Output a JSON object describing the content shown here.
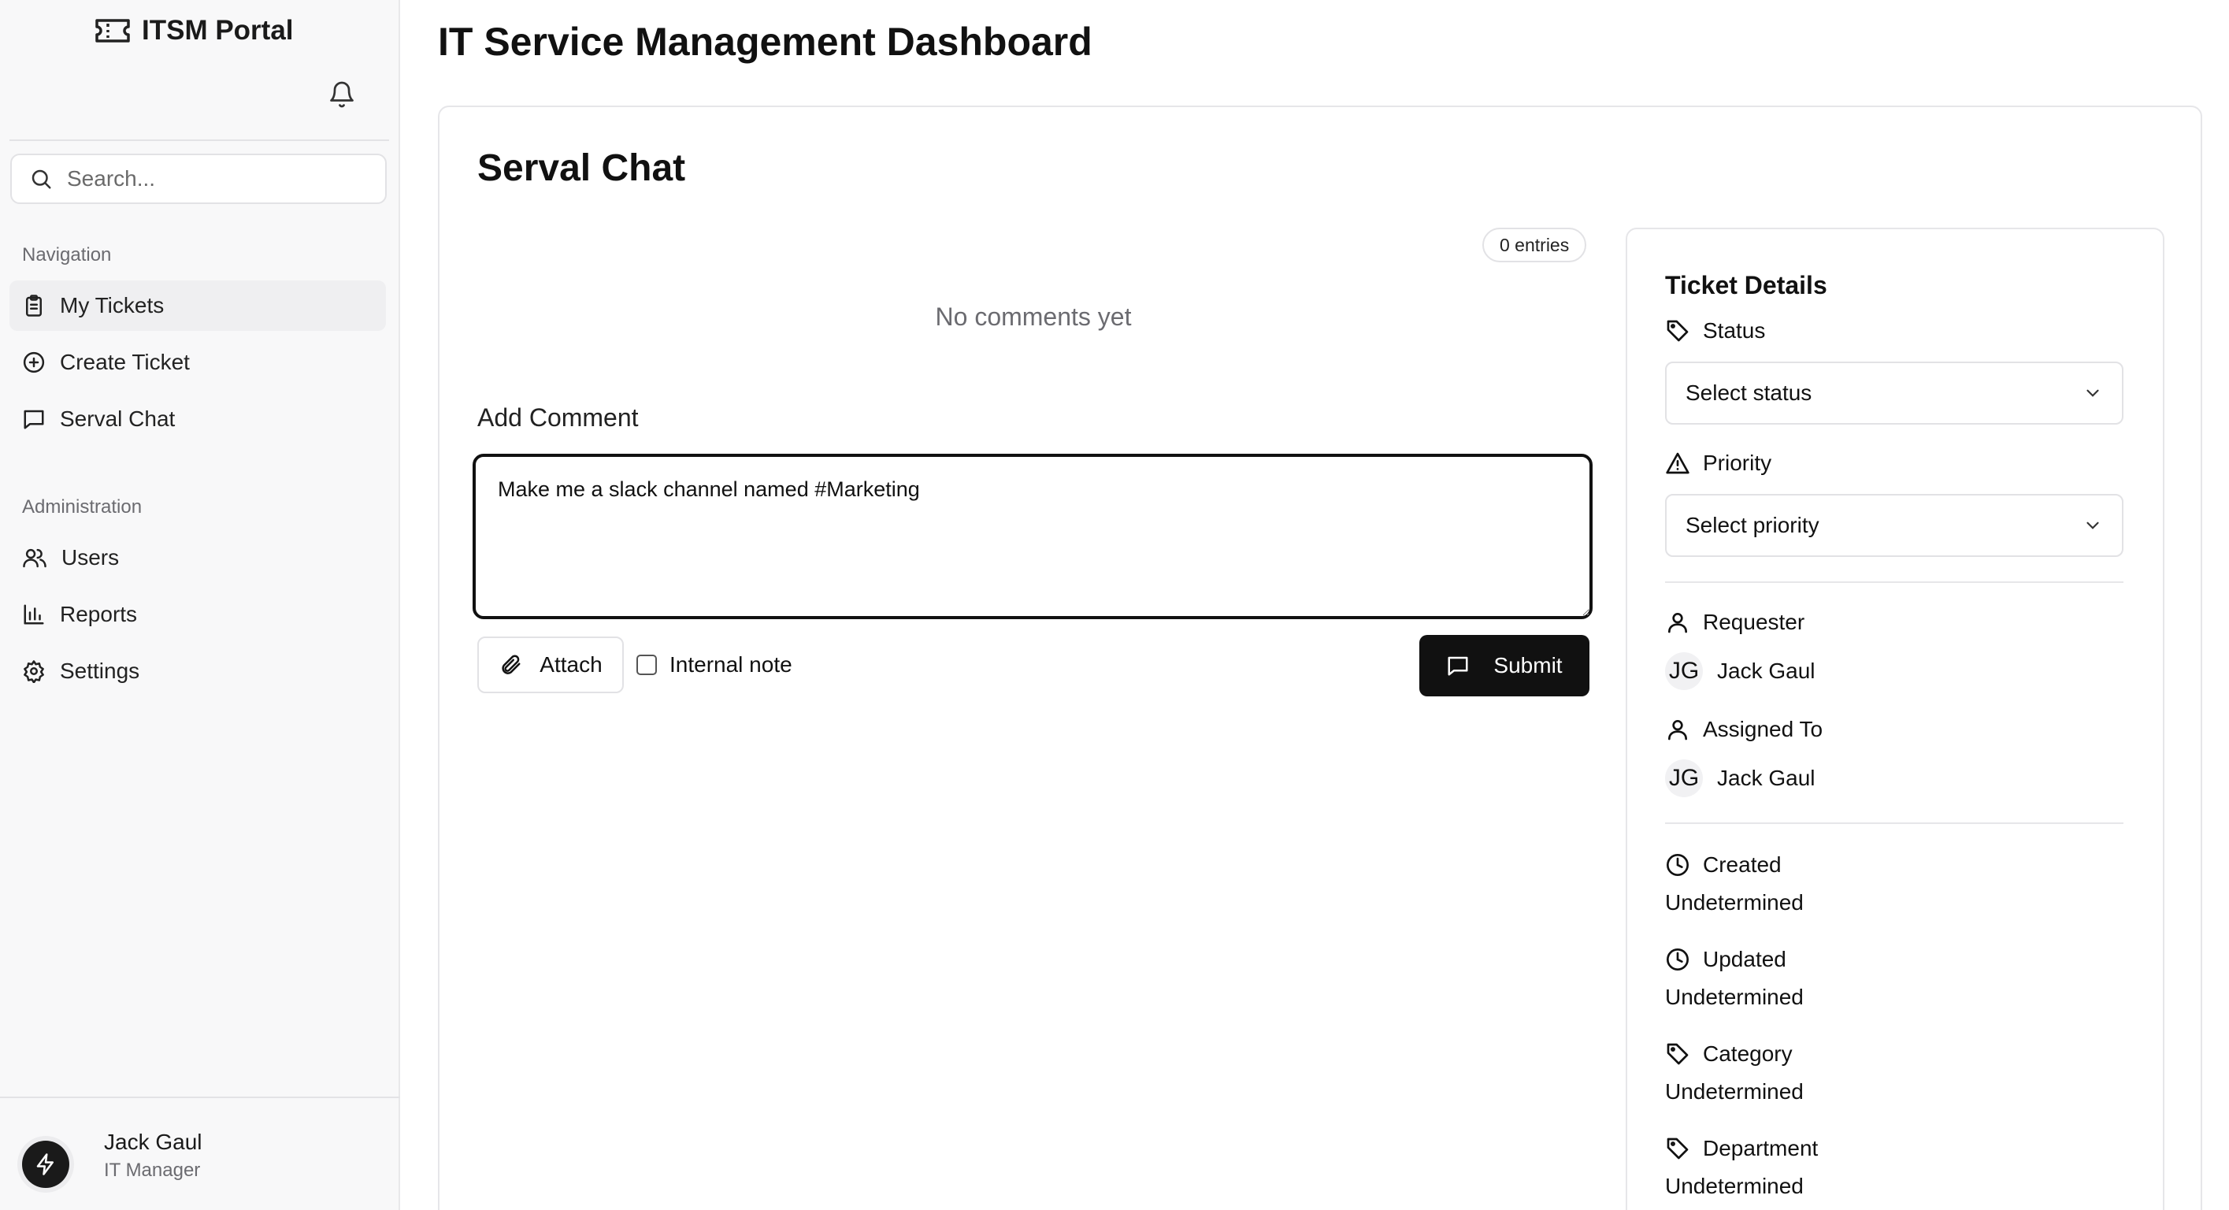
{
  "sidebar": {
    "brand": "ITSM Portal",
    "search_placeholder": "Search...",
    "nav_label": "Navigation",
    "nav_items": [
      {
        "label": "My Tickets",
        "icon": "clipboard-icon",
        "active": true
      },
      {
        "label": "Create Ticket",
        "icon": "plus-circle-icon",
        "active": false
      },
      {
        "label": "Serval Chat",
        "icon": "chat-icon",
        "active": false
      }
    ],
    "admin_label": "Administration",
    "admin_items": [
      {
        "label": "Users",
        "icon": "users-icon"
      },
      {
        "label": "Reports",
        "icon": "bar-chart-icon"
      },
      {
        "label": "Settings",
        "icon": "gear-icon"
      }
    ],
    "user": {
      "name": "Jack Gaul",
      "role": "IT Manager"
    }
  },
  "header": {
    "title": "IT Service Management Dashboard"
  },
  "chat": {
    "title": "Serval Chat",
    "entries": "0 entries",
    "empty": "No comments yet",
    "add_comment": "Add Comment",
    "comment_value": "Make me a slack channel named #Marketing",
    "attach": "Attach",
    "internal_note": "Internal note",
    "submit": "Submit"
  },
  "details": {
    "title": "Ticket Details",
    "status_label": "Status",
    "status_value": "Select status",
    "priority_label": "Priority",
    "priority_value": "Select priority",
    "requester_label": "Requester",
    "requester_initials": "JG",
    "requester_name": "Jack Gaul",
    "assigned_label": "Assigned To",
    "assigned_initials": "JG",
    "assigned_name": "Jack Gaul",
    "created_label": "Created",
    "created_value": "Undetermined",
    "updated_label": "Updated",
    "updated_value": "Undetermined",
    "category_label": "Category",
    "category_value": "Undetermined",
    "department_label": "Department",
    "department_value": "Undetermined"
  }
}
